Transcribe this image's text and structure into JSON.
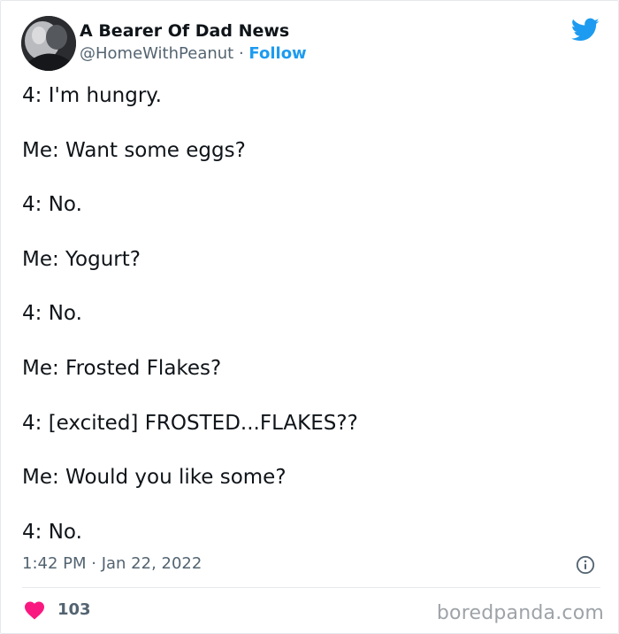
{
  "tweet": {
    "author_name": "A Bearer Of Dad News",
    "handle": "@HomeWithPeanut",
    "separator": "·",
    "follow_label": "Follow",
    "lines": [
      "4: I'm hungry.",
      "Me: Want some eggs?",
      "4: No.",
      "Me: Yogurt?",
      "4: No.",
      "Me: Frosted Flakes?",
      "4: [excited] FROSTED...FLAKES??",
      "Me: Would you like some?",
      "4: No."
    ],
    "timestamp": "1:42 PM · Jan 22, 2022",
    "like_count": "103"
  },
  "watermark": "boredpanda.com",
  "icons": {
    "logo": "twitter-bird-icon",
    "info": "info-icon",
    "like": "heart-icon"
  },
  "colors": {
    "accent": "#1d9bf0",
    "heart": "#f91880",
    "text_primary": "#0f1419",
    "text_secondary": "#536471"
  }
}
